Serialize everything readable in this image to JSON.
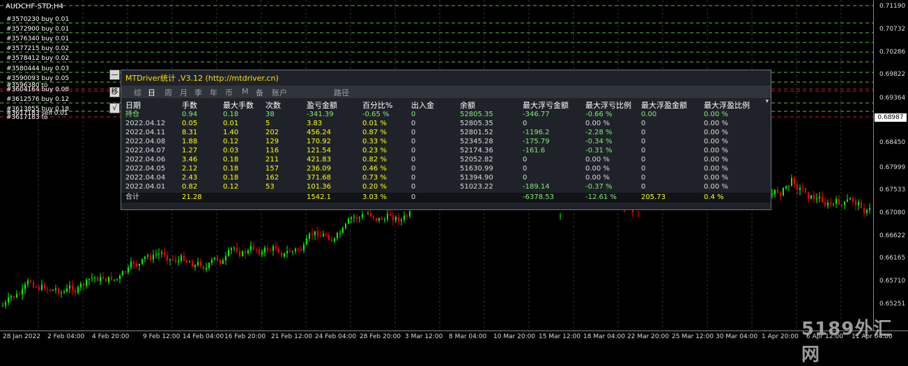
{
  "symbol_title": "AUDCHF-STD,H4",
  "orders": [
    "#3570230 buy 0.01",
    "#3572900 buy 0.01",
    "#3576340 buy 0.01",
    "#3577215 buy 0.02",
    "#3578412 buy 0.02",
    "#3580444 buy 0.03",
    "#3590093 buy 0.05",
    "#3596380 to",
    "#3604164 buy 0.08",
    "#3612576 buy 0.12",
    "#3613855 buy 0.18",
    "#3617183 sell 0.01",
    "#3617183 to"
  ],
  "price_axis": [
    "0.71190",
    "0.70732",
    "0.70286",
    "0.69822",
    "0.69364",
    "0.68906",
    "0.68450",
    "0.67999",
    "0.67533",
    "0.67080",
    "0.66622",
    "0.66165",
    "0.65710",
    "0.65251"
  ],
  "current_price": "0.68987",
  "time_axis": [
    "28 Jan 2022",
    "2 Feb 04:00",
    "4 Feb 20:00",
    "9 Feb 12:00",
    "14 Feb 04:00",
    "16 Feb 20:00",
    "21 Feb 12:00",
    "24 Feb 04:00",
    "28 Feb 20:00",
    "3 Mar 12:00",
    "8 Mar 04:00",
    "10 Mar 20:00",
    "15 Mar 12:00",
    "18 Mar 04:00",
    "22 Mar 20:00",
    "25 Mar 12:00",
    "30 Mar 04:00",
    "1 Apr 20:00",
    "6 Apr 12:00",
    "11 Apr 04:00"
  ],
  "watermark": "5189外汇网",
  "side_buttons": [
    "—",
    "移",
    "√"
  ],
  "panel": {
    "title": "MTDriver统计 ,V3.12 (http://mtdriver.cn)",
    "tabs": [
      "综",
      "日",
      "周",
      "月",
      "季",
      "年",
      "币",
      "M",
      "备",
      "账户",
      "路径"
    ],
    "active_tab": "日",
    "dropdown_arrow": "▾",
    "columns": [
      "日期",
      "手数",
      "最大手数",
      "次数",
      "盈亏金额",
      "百分比%",
      "出入金",
      "余额",
      "最大浮亏金额",
      "最大浮亏比例",
      "最大浮盈金额",
      "最大浮盈比例"
    ],
    "holding": [
      "持仓",
      "0.94",
      "0.18",
      "38",
      "-341.39",
      "-0.65 %",
      "0",
      "52805.35",
      "-346.77",
      "-0.66 %",
      "0.00",
      "0.00 %"
    ],
    "rows": [
      [
        "2022.04.12",
        "0.05",
        "0.01",
        "5",
        "3.83",
        "0.01 %",
        "0",
        "52805.35",
        "0",
        "0.00 %",
        "0",
        "0.00 %"
      ],
      [
        "2022.04.11",
        "8.31",
        "1.40",
        "202",
        "456.24",
        "0.87 %",
        "0",
        "52801.52",
        "-1196.2",
        "-2.28 %",
        "0",
        "0.00 %"
      ],
      [
        "2022.04.08",
        "1.88",
        "0.12",
        "129",
        "170.92",
        "0.33 %",
        "0",
        "52345.28",
        "-175.79",
        "-0.34 %",
        "0",
        "0.00 %"
      ],
      [
        "2022.04.07",
        "1.27",
        "0.03",
        "116",
        "121.54",
        "0.23 %",
        "0",
        "52174.36",
        "-161.6",
        "-0.31 %",
        "0",
        "0.00 %"
      ],
      [
        "2022.04.06",
        "3.46",
        "0.18",
        "211",
        "421.83",
        "0.82 %",
        "0",
        "52052.82",
        "0",
        "0.00 %",
        "0",
        "0.00 %"
      ],
      [
        "2022.04.05",
        "2.12",
        "0.18",
        "157",
        "236.09",
        "0.46 %",
        "0",
        "51630.99",
        "0",
        "0.00 %",
        "0",
        "0.00 %"
      ],
      [
        "2022.04.04",
        "2.43",
        "0.18",
        "162",
        "371.68",
        "0.73 %",
        "0",
        "51394.90",
        "0",
        "0.00 %",
        "0",
        "0.00 %"
      ],
      [
        "2022.04.01",
        "0.82",
        "0.12",
        "53",
        "101.36",
        "0.20 %",
        "0",
        "51023.22",
        "-189.14",
        "-0.37 %",
        "0",
        "0.00 %"
      ]
    ],
    "total": [
      "合计",
      "21.28",
      "",
      "",
      "1542.1",
      "3.03 %",
      "0",
      "",
      "-6378.53",
      "-12.61 %",
      "205.73",
      "0.4 %"
    ]
  },
  "colors": {
    "bull": "#00ff00",
    "bear": "#ff0000",
    "yellow": "#ffff00",
    "green_text": "#86e87a",
    "panel_bg": "#1f2329"
  }
}
